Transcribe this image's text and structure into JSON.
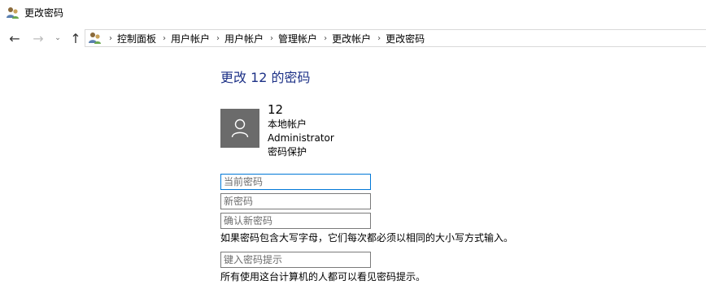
{
  "window": {
    "title": "更改密码",
    "title_icon": "user-accounts-icon"
  },
  "nav": {
    "back_icon": "arrow-left-icon",
    "forward_icon": "arrow-right-icon",
    "recent_icon": "chevron-down-icon",
    "up_icon": "arrow-up-icon",
    "back_glyph": "←",
    "forward_glyph": "→",
    "recent_glyph": "⌄",
    "up_glyph": "↑"
  },
  "breadcrumb": {
    "icon": "user-accounts-icon",
    "separator": "›",
    "items": [
      {
        "label": "控制面板"
      },
      {
        "label": "用户帐户"
      },
      {
        "label": "用户帐户"
      },
      {
        "label": "管理帐户"
      },
      {
        "label": "更改帐户"
      },
      {
        "label": "更改密码"
      }
    ]
  },
  "main": {
    "heading": "更改 12 的密码",
    "account": {
      "avatar_icon": "user-icon",
      "name": "12",
      "type": "本地帐户",
      "role": "Administrator",
      "protection": "密码保护"
    },
    "fields": {
      "current_password_placeholder": "当前密码",
      "new_password_placeholder": "新密码",
      "confirm_password_placeholder": "确认新密码",
      "hint_placeholder": "键入密码提示"
    },
    "case_note": "如果密码包含大写字母，它们每次都必须以相同的大小写方式输入。",
    "hint_note": "所有使用这台计算机的人都可以看见密码提示。"
  },
  "colors": {
    "heading": "#1e3287",
    "avatar_bg": "#6b6b6b",
    "focus_border": "#0078d7",
    "field_border": "#7a7a7a"
  }
}
